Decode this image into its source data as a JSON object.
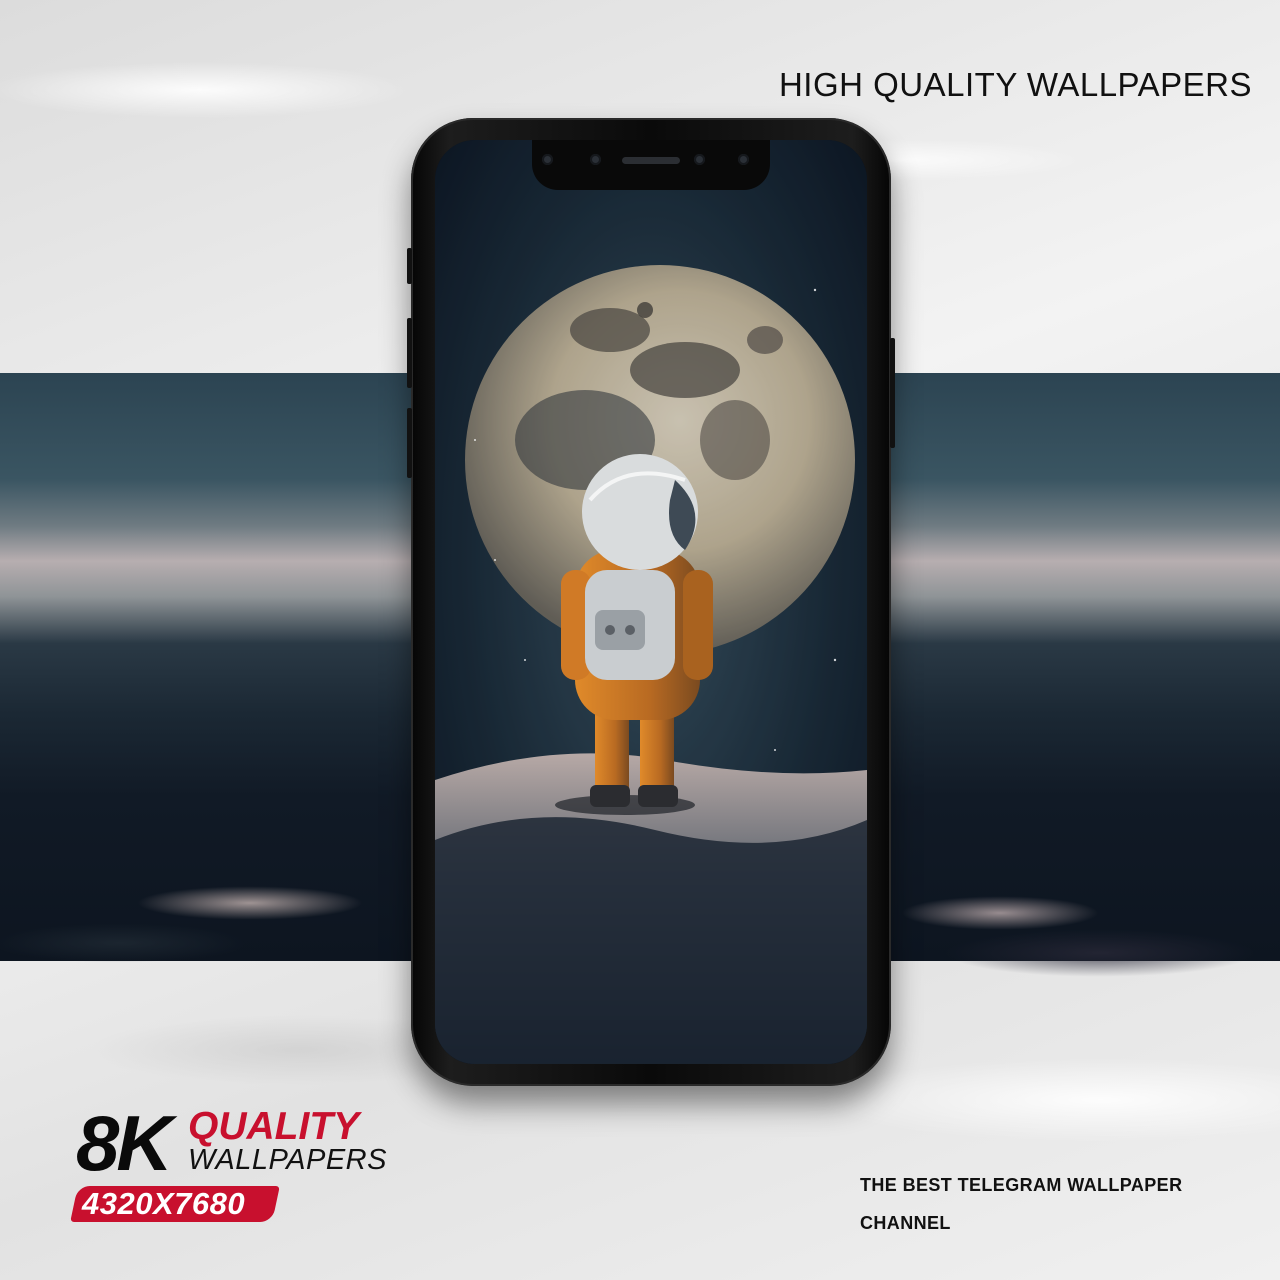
{
  "headline": "HIGH QUALITY WALLPAPERS",
  "badge": {
    "big": "8K",
    "quality": "QUALITY",
    "wallpapers": "WALLPAPERS",
    "resolution": "4320X7680"
  },
  "footer": {
    "line1": "THE BEST TELEGRAM WALLPAPER",
    "line2": "CHANNEL"
  },
  "colors": {
    "accent": "#c8102e",
    "text": "#111111",
    "band_dark": "#0d1520"
  }
}
